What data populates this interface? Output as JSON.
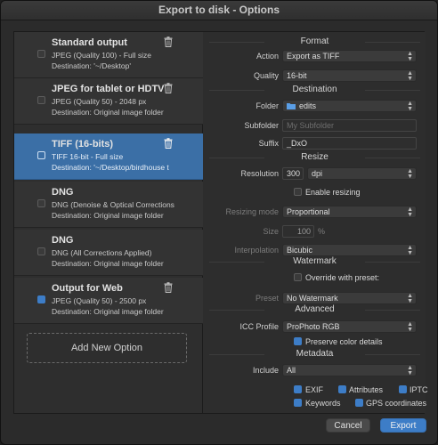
{
  "window": {
    "title": "Export to disk - Options"
  },
  "options": [
    {
      "title": "Standard output",
      "line1": "JPEG (Quality 100) - Full size",
      "line2": "Destination: '~/Desktop'",
      "checked": false,
      "selected": false
    },
    {
      "title": "JPEG for tablet or HDTV",
      "line1": "JPEG (Quality 50) - 2048 px",
      "line2": "Destination: Original image folder",
      "checked": false,
      "selected": false
    },
    {
      "title": "TIFF (16-bits)",
      "line1": "TIFF 16-bit - Full size",
      "line2": "Destination: '~/Desktop/birdhouse t",
      "checked": false,
      "selected": true
    },
    {
      "title": "DNG",
      "line1": "DNG (Denoise & Optical Corrections",
      "line2": "Destination: Original image folder",
      "checked": false,
      "selected": false
    },
    {
      "title": "DNG",
      "line1": "DNG (All Corrections Applied)",
      "line2": "Destination: Original image folder",
      "checked": false,
      "selected": false
    },
    {
      "title": "Output for Web",
      "line1": "JPEG (Quality 50) - 2500 px",
      "line2": "Destination: Original image folder",
      "checked": true,
      "selected": false
    }
  ],
  "add_option_label": "Add New Option",
  "format": {
    "header": "Format",
    "action_label": "Action",
    "action_value": "Export as TIFF",
    "quality_label": "Quality",
    "quality_value": "16-bit"
  },
  "destination": {
    "header": "Destination",
    "folder_label": "Folder",
    "folder_value": "edits",
    "subfolder_label": "Subfolder",
    "subfolder_placeholder": "My Subfolder",
    "suffix_label": "Suffix",
    "suffix_value": "_DxO"
  },
  "resize": {
    "header": "Resize",
    "resolution_label": "Resolution",
    "resolution_value": "300",
    "resolution_unit": "dpi",
    "enable_resizing_label": "Enable resizing",
    "resizing_mode_label": "Resizing mode",
    "resizing_mode_value": "Proportional",
    "size_label": "Size",
    "size_value": "100",
    "size_unit": "%",
    "interpolation_label": "Interpolation",
    "interpolation_value": "Bicubic"
  },
  "watermark": {
    "header": "Watermark",
    "override_label": "Override with preset:",
    "preset_label": "Preset",
    "preset_value": "No Watermark"
  },
  "advanced": {
    "header": "Advanced",
    "icc_label": "ICC Profile",
    "icc_value": "ProPhoto RGB",
    "preserve_label": "Preserve color details"
  },
  "metadata": {
    "header": "Metadata",
    "include_label": "Include",
    "include_value": "All",
    "exif_label": "EXIF",
    "attributes_label": "Attributes",
    "iptc_label": "IPTC",
    "keywords_label": "Keywords",
    "gps_label": "GPS coordinates"
  },
  "buttons": {
    "cancel": "Cancel",
    "export": "Export"
  },
  "colors": {
    "accent": "#3d7dc7",
    "selected_row": "#3b6fa6",
    "background": "#2b2b2b"
  }
}
